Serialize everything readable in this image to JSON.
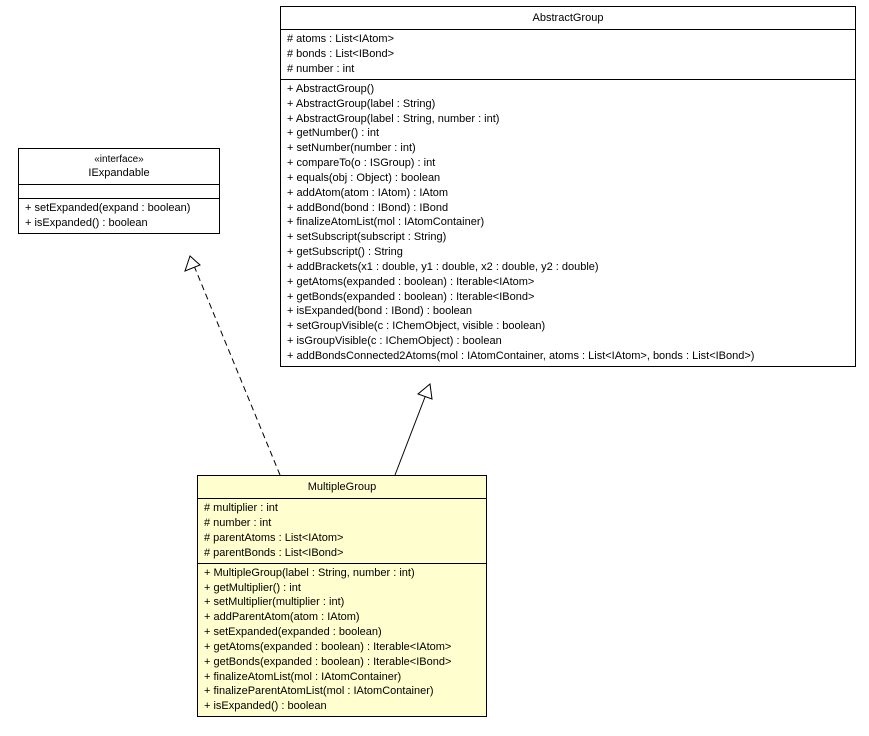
{
  "interface_box": {
    "stereotype": "«interface»",
    "name": "IExpandable",
    "methods": [
      "+ setExpanded(expand : boolean)",
      "+ isExpanded() : boolean"
    ]
  },
  "abstract_box": {
    "name": "AbstractGroup",
    "attributes": [
      "# atoms : List<IAtom>",
      "# bonds : List<IBond>",
      "# number : int"
    ],
    "methods": [
      "+ AbstractGroup()",
      "+ AbstractGroup(label : String)",
      "+ AbstractGroup(label : String, number : int)",
      "+ getNumber() : int",
      "+ setNumber(number : int)",
      "+ compareTo(o : ISGroup) : int",
      "+ equals(obj : Object) : boolean",
      "+ addAtom(atom : IAtom) : IAtom",
      "+ addBond(bond : IBond) : IBond",
      "+ finalizeAtomList(mol : IAtomContainer)",
      "+ setSubscript(subscript : String)",
      "+ getSubscript() : String",
      "+ addBrackets(x1 : double, y1 : double, x2 : double, y2 : double)",
      "+ getAtoms(expanded : boolean) : Iterable<IAtom>",
      "+ getBonds(expanded : boolean) : Iterable<IBond>",
      "+ isExpanded(bond : IBond) : boolean",
      "+ setGroupVisible(c : IChemObject, visible : boolean)",
      "+ isGroupVisible(c : IChemObject) : boolean",
      "+ addBondsConnected2Atoms(mol : IAtomContainer, atoms : List<IAtom>, bonds : List<IBond>)"
    ]
  },
  "multiple_box": {
    "name": "MultipleGroup",
    "attributes": [
      "# multiplier : int",
      "# number : int",
      "# parentAtoms : List<IAtom>",
      "# parentBonds : List<IBond>"
    ],
    "methods": [
      "+ MultipleGroup(label : String, number : int)",
      "+ getMultiplier() : int",
      "+ setMultiplier(multiplier : int)",
      "+ addParentAtom(atom : IAtom)",
      "+ setExpanded(expanded : boolean)",
      "+ getAtoms(expanded : boolean) : Iterable<IAtom>",
      "+ getBonds(expanded : boolean) : Iterable<IBond>",
      "+ finalizeAtomList(mol : IAtomContainer)",
      "+ finalizeParentAtomList(mol : IAtomContainer)",
      "+ isExpanded() : boolean"
    ]
  }
}
